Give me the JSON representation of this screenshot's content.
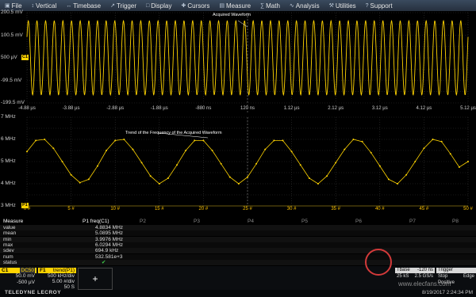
{
  "menubar": {
    "items": [
      {
        "label": "File",
        "icon": "file-icon"
      },
      {
        "label": "Vertical",
        "icon": "vertical-icon"
      },
      {
        "label": "Timebase",
        "icon": "timebase-icon"
      },
      {
        "label": "Trigger",
        "icon": "trigger-icon"
      },
      {
        "label": "Display",
        "icon": "display-icon"
      },
      {
        "label": "Cursors",
        "icon": "cursors-icon"
      },
      {
        "label": "Measure",
        "icon": "measure-icon"
      },
      {
        "label": "Math",
        "icon": "math-icon"
      },
      {
        "label": "Analysis",
        "icon": "analysis-icon"
      },
      {
        "label": "Utilities",
        "icon": "utilities-icon"
      },
      {
        "label": "Support",
        "icon": "support-icon"
      }
    ]
  },
  "upper_grid": {
    "y_labels": [
      "200.5 mV",
      "100.5 mV",
      "500 µV",
      "-99.5 mV",
      "-199.5 mV"
    ],
    "x_labels": [
      "-4.88 µs",
      "-3.88 µs",
      "-2.88 µs",
      "-1.88 µs",
      "-880 ns",
      "120 ns",
      "1.12 µs",
      "2.12 µs",
      "3.12 µs",
      "4.12 µs",
      "5.12 µs"
    ],
    "annotation": "Acquired Waveform",
    "channel_marker": "C1"
  },
  "lower_grid": {
    "y_labels": [
      "7 MHz",
      "6 MHz",
      "5 MHz",
      "4 MHz",
      "3 MHz"
    ],
    "x_labels": [
      "0 #",
      "5 #",
      "10 #",
      "15 #",
      "20 #",
      "25 #",
      "30 #",
      "35 #",
      "40 #",
      "45 #",
      "50 #"
    ],
    "annotation": "Trend of the Frequency of the Acquired Waveform",
    "channel_marker": "P1"
  },
  "chart_data": {
    "type": "line",
    "series": [
      {
        "name": "trend(P1)",
        "x": [
          0,
          1,
          2,
          3,
          4,
          5,
          6,
          7,
          8,
          9,
          10,
          11,
          12,
          13,
          14,
          15,
          16,
          17,
          18,
          19,
          20,
          21,
          22,
          23,
          24,
          25,
          26,
          27,
          28,
          29,
          30,
          31,
          32,
          33,
          34,
          35,
          36,
          37,
          38,
          39,
          40,
          41,
          42,
          43,
          44,
          45,
          46,
          47,
          48,
          49,
          50
        ],
        "values": [
          5.45,
          5.95,
          6.0,
          5.6,
          5.0,
          4.4,
          4.05,
          4.2,
          4.8,
          5.5,
          5.95,
          6.0,
          5.55,
          4.95,
          4.35,
          4.0,
          4.25,
          4.85,
          5.5,
          5.95,
          5.95,
          5.5,
          4.9,
          4.3,
          4.0,
          4.3,
          4.9,
          5.55,
          5.95,
          5.95,
          5.45,
          4.85,
          4.25,
          4.0,
          4.35,
          4.95,
          5.55,
          6.0,
          5.9,
          5.4,
          4.8,
          4.2,
          4.0,
          4.4,
          5.0,
          5.6,
          6.0,
          5.9,
          5.35,
          4.75,
          5.0
        ]
      }
    ],
    "xlabel": "#",
    "ylabel": "MHz",
    "ylim": [
      3,
      7
    ],
    "xlim": [
      0,
      50
    ],
    "grid": true
  },
  "waveform": {
    "color": "#ffd400",
    "cycles": 51,
    "amplitude_mV": 100
  },
  "measure": {
    "header": "Measure",
    "column_headers": [
      "P1 freq(C1)",
      "P2",
      "P3",
      "P4",
      "P5",
      "P6",
      "P7",
      "P8"
    ],
    "rows": [
      {
        "label": "value",
        "p1": "4.8834 MHz"
      },
      {
        "label": "mean",
        "p1": "5.0895 MHz"
      },
      {
        "label": "min",
        "p1": "3.9976 MHz"
      },
      {
        "label": "max",
        "p1": "6.0294 MHz"
      },
      {
        "label": "sdev",
        "p1": "694.9 kHz"
      },
      {
        "label": "num",
        "p1": "532.581e+3"
      },
      {
        "label": "status",
        "p1": "✔"
      }
    ]
  },
  "channel_c1": {
    "label": "C1",
    "coupling": "DC50",
    "scale": "50.0 mV",
    "offset": "-500 µV"
  },
  "trace_f1": {
    "label": "F1",
    "name": "trend(P1)",
    "scale": "500 kHz/div",
    "hscale": "5.00 #/div",
    "count": "50 S"
  },
  "add_button": "+",
  "timebase": {
    "label": "Tbase",
    "delay": "-120 ns",
    "rate": "25 kS",
    "srate": "2.5 GS/s"
  },
  "trigger": {
    "label": "Trigger",
    "mode": "Stop",
    "type": "Edge",
    "slope": "Positive"
  },
  "brand": "TELEDYNE LECROY",
  "watermark": "www.elecfans.com",
  "datetime": "8/19/2017 2:24:34 PM",
  "colors": {
    "trace": "#ffd400",
    "grid": "#3a3a3a",
    "accent": "#ffc400"
  }
}
